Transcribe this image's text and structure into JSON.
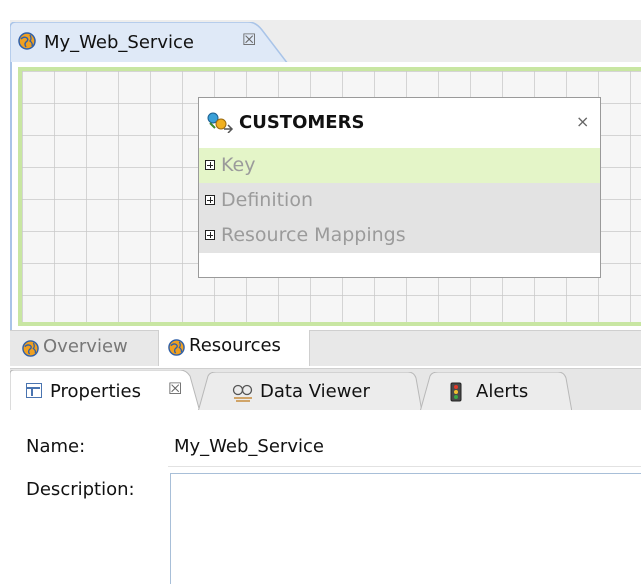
{
  "editor": {
    "tab_title": "My_Web_Service",
    "tab_close": "☒",
    "tab_icon": "web-service-globe-icon"
  },
  "node": {
    "title": "CUSTOMERS",
    "close": "×",
    "icon": "data-object-icon",
    "rows": [
      {
        "label": "Key"
      },
      {
        "label": "Definition"
      },
      {
        "label": "Resource Mappings"
      }
    ]
  },
  "editor_bottom_tabs": {
    "overview": "Overview",
    "resources": "Resources",
    "selected": "Resources"
  },
  "properties_view": {
    "tabs": [
      {
        "label": "Properties",
        "close": "☒",
        "icon": "properties-icon"
      },
      {
        "label": "Data Viewer",
        "icon": "data-viewer-icon"
      },
      {
        "label": "Alerts",
        "icon": "alerts-icon"
      }
    ],
    "name_label": "Name:",
    "name_value": "My_Web_Service",
    "description_label": "Description:",
    "description_value": ""
  },
  "colors": {
    "canvas_border": "#c8e6a2",
    "selected_row": "#e4f5c8",
    "tab_border": "#a9c4e8",
    "row_text": "#9b9b9b"
  }
}
